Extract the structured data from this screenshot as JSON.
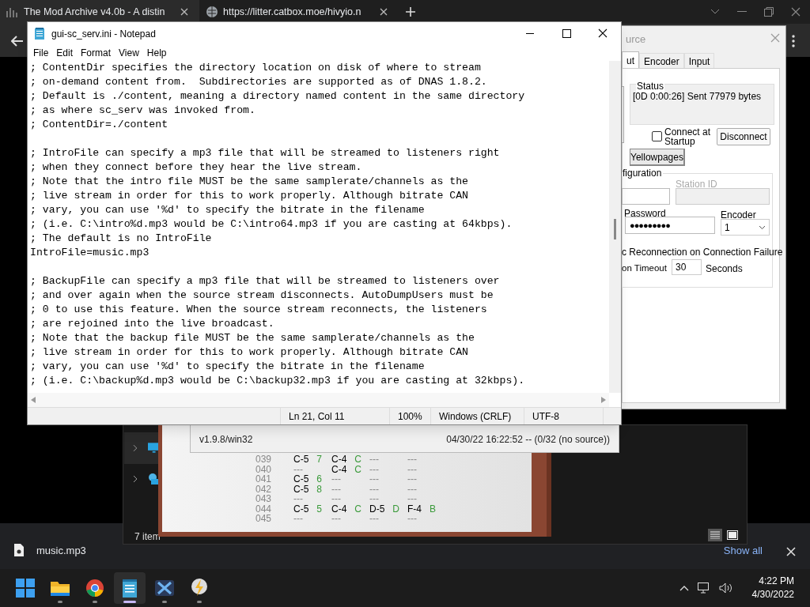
{
  "browser": {
    "tabs": [
      {
        "title": "The Mod Archive v4.0b - A distin",
        "selected": true
      },
      {
        "title": "https://litter.catbox.moe/hivyio.n",
        "selected": false
      }
    ]
  },
  "notepad": {
    "title": "gui-sc_serv.ini - Notepad",
    "menu": [
      "File",
      "Edit",
      "Format",
      "View",
      "Help"
    ],
    "paragraphs": [
      [
        "; ContentDir specifies the directory location on disk of where to stream",
        "; on-demand content from.  Subdirectories are supported as of DNAS 1.8.2.",
        "; Default is ./content, meaning a directory named content in the same directory",
        "; as where sc_serv was invoked from.",
        "; ContentDir=./content"
      ],
      [
        "; IntroFile can specify a mp3 file that will be streamed to listeners right",
        "; when they connect before they hear the live stream.",
        "; Note that the intro file MUST be the same samplerate/channels as the",
        "; live stream in order for this to work properly. Although bitrate CAN",
        "; vary, you can use '%d' to specify the bitrate in the filename",
        "; (i.e. C:\\intro%d.mp3 would be C:\\intro64.mp3 if you are casting at 64kbps).",
        "; The default is no IntroFile",
        "IntroFile=music.mp3"
      ],
      [
        "; BackupFile can specify a mp3 file that will be streamed to listeners over",
        "; and over again when the source stream disconnects. AutoDumpUsers must be",
        "; 0 to use this feature. When the source stream reconnects, the listeners",
        "; are rejoined into the live broadcast.",
        "; Note that the backup file MUST be the same samplerate/channels as the",
        "; live stream in order for this to work properly. Although bitrate CAN",
        "; vary, you can use '%d' to specify the bitrate in the filename",
        "; (i.e. C:\\backup%d.mp3 would be C:\\backup32.mp3 if you are casting at 32kbps)."
      ]
    ],
    "status_bar": [
      "Ln 21, Col 11",
      "100%",
      "Windows (CRLF)",
      "UTF-8"
    ]
  },
  "dsp_window": {
    "title": "urce",
    "tabs": [
      {
        "label": "ut",
        "selected": true
      },
      {
        "label": "Encoder",
        "selected": false
      },
      {
        "label": "Input",
        "selected": false
      }
    ],
    "status_label": "Status",
    "status_text": "[0D 0:00:26] Sent 77979 bytes",
    "connect_at_startup": {
      "label": "Connect at Startup",
      "checked": false
    },
    "disconnect_button": "Disconnect",
    "yellowpages_button": "Yellowpages",
    "config_label": "figuration",
    "station_id_label": "Station ID",
    "password_label": "Password",
    "password_value": "●●●●●●●●●",
    "encoder_label": "Encoder",
    "encoder_value": "1",
    "reconnect_label": "c Reconnection on Connection Failure",
    "timeout_label": "on Timeout",
    "timeout_value": "30",
    "seconds_label": "Seconds"
  },
  "server_window": {
    "version": "v1.9.8/win32",
    "status": "04/30/22 16:22:52 -- (0/32 (no source))"
  },
  "tracker": {
    "rows": [
      {
        "row": "039",
        "channels": [
          {
            "note": "C-5",
            "instrument": "7"
          },
          {
            "note": "C-4",
            "instrument": "C"
          },
          {
            "note": "---"
          },
          {
            "note": "---"
          }
        ]
      },
      {
        "row": "040",
        "channels": [
          {
            "note": "---"
          },
          {
            "note": "C-4",
            "instrument": "C"
          },
          {
            "note": "---"
          },
          {
            "note": "---"
          }
        ]
      },
      {
        "row": "041",
        "channels": [
          {
            "note": "C-5",
            "instrument": "6"
          },
          {
            "note": "---"
          },
          {
            "note": "---"
          },
          {
            "note": "---"
          }
        ]
      },
      {
        "row": "042",
        "channels": [
          {
            "note": "C-5",
            "instrument": "8"
          },
          {
            "note": "---"
          },
          {
            "note": "---"
          },
          {
            "note": "---"
          }
        ]
      },
      {
        "row": "043",
        "channels": [
          {
            "note": "---"
          },
          {
            "note": "---"
          },
          {
            "note": "---"
          },
          {
            "note": "---"
          }
        ]
      },
      {
        "row": "044",
        "channels": [
          {
            "note": "C-5",
            "instrument": "5"
          },
          {
            "note": "C-4",
            "instrument": "C"
          },
          {
            "note": "D-5",
            "instrument": "D"
          },
          {
            "note": "F-4",
            "instrument": "B"
          }
        ]
      },
      {
        "row": "045",
        "channels": [
          {
            "note": "---"
          },
          {
            "note": "---"
          },
          {
            "note": "---"
          },
          {
            "note": "---"
          }
        ]
      }
    ]
  },
  "explorer": {
    "item_count": "7 item"
  },
  "download_bar": {
    "file": "music.mp3",
    "show_all": "Show all"
  },
  "taskbar": {
    "apps": [
      {
        "kind": "start",
        "active": false
      },
      {
        "kind": "folder",
        "active": false
      },
      {
        "kind": "browser",
        "active": false
      },
      {
        "kind": "notepad",
        "active": true
      },
      {
        "kind": "player",
        "active": false
      },
      {
        "kind": "tool",
        "active": false
      }
    ],
    "time": "4:22 PM",
    "date": "4/30/2022"
  }
}
